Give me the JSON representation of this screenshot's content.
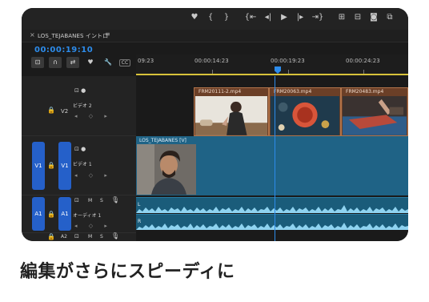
{
  "toolbar": {
    "icons": [
      "marker-icon",
      "mark-in-icon",
      "mark-out-icon",
      "go-to-in-icon",
      "step-back-icon",
      "play-icon",
      "step-forward-icon",
      "go-to-out-icon",
      "lift-icon",
      "extract-icon",
      "export-frame-icon",
      "comparison-view-icon"
    ],
    "glyphs": [
      "♥",
      "{",
      "}",
      "{⇤",
      "◂|",
      "▶",
      "|▸",
      "⇥}",
      "⊞",
      "⊟",
      "◙",
      "⧉"
    ]
  },
  "sequence": {
    "close": "×",
    "name": "LOS_TEJABANES イントロ",
    "menu": "≡",
    "timecode": "00:00:19:10"
  },
  "timeline_tools": [
    "⊡",
    "∩",
    "⇄",
    "♥",
    "🔧",
    "CC"
  ],
  "ruler": {
    "labels": [
      "09:23",
      "00:00:14:23",
      "00:00:19:23",
      "00:00:24:23"
    ]
  },
  "tracks": {
    "v2": {
      "label": "V2",
      "name": "ビデオ 2",
      "lock": "🔒"
    },
    "v1": {
      "target": "V1",
      "label": "V1",
      "name": "ビデオ 1",
      "lock": "🔒"
    },
    "a1": {
      "target": "A1",
      "label": "A1",
      "name": "オーディオ 1",
      "lock": "🔒",
      "m": "M",
      "s": "S",
      "voice": "🎙"
    },
    "a2": {
      "label": "A2",
      "lock": "🔒",
      "m": "M",
      "s": "S",
      "voice": "🎙"
    },
    "kf": "◂ ◇ ▸",
    "eye": "⊡ ●"
  },
  "clips": {
    "v2": [
      "FRM20111-2.mp4",
      "FRM20063.mp4",
      "FRM20483.mp4"
    ],
    "v1": "LOS_TEJABANES [V]",
    "audio_tags": [
      "L",
      "R"
    ]
  },
  "caption": "編集がさらにスピーディに",
  "colors": {
    "accent": "#2d8ceb",
    "target": "#2560c9",
    "v2_clip": "#b0734a",
    "v1_clip": "#1f6386",
    "audio": "#1a5c7a"
  }
}
